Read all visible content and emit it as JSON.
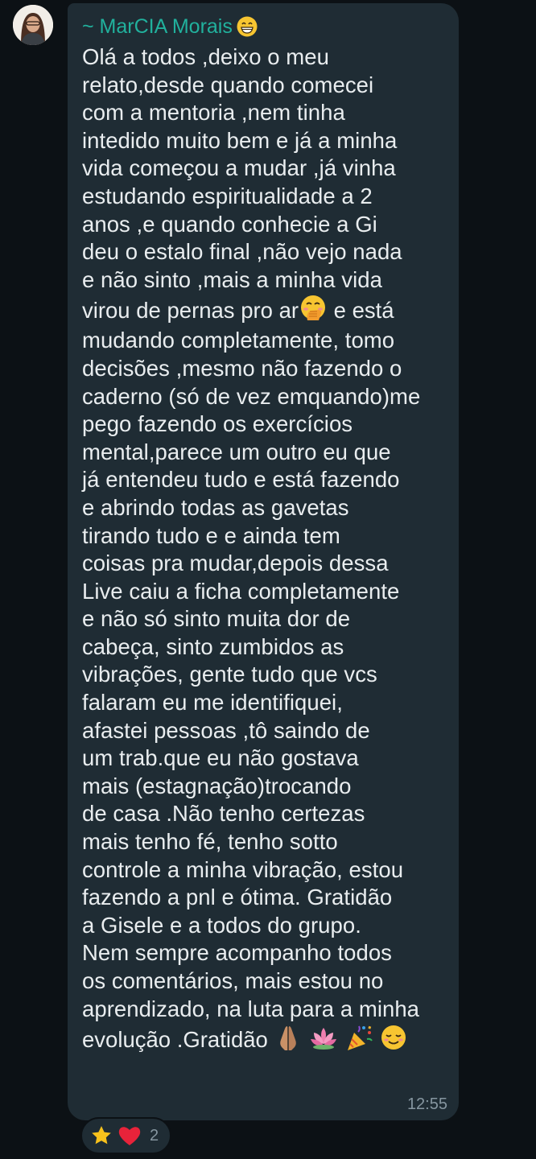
{
  "message": {
    "sender": {
      "name": "~ MarCIA Morais",
      "emoji_icon": "grinning-face-icon"
    },
    "body_lines": [
      "Olá a todos ,deixo o meu",
      "relato,desde quando comecei",
      "com a mentoria ,nem tinha",
      "intedido muito bem e já a minha",
      "vida começou a mudar ,já vinha",
      "estudando espiritualidade a 2",
      "anos ,e quando conhecie a Gi",
      "deu o estalo final ,não vejo nada",
      "e não sinto ,mais a minha vida"
    ],
    "line_virou_before": "virou de pernas pro ar",
    "line_virou_emoji": "face-with-hand-over-mouth-icon",
    "line_virou_after": " e está",
    "body_lines_2": [
      "mudando completamente, tomo",
      "decisões ,mesmo não fazendo o",
      "caderno (só de vez emquando)me",
      "pego fazendo os exercícios",
      "mental,parece um outro eu que",
      "já entendeu tudo e está fazendo",
      "e abrindo todas as gavetas",
      "tirando tudo e  e ainda tem",
      "coisas pra mudar,depois dessa",
      "Live caiu a ficha completamente",
      "e não só sinto muita dor de",
      "cabeça, sinto zumbidos as",
      "vibrações, gente tudo que vcs",
      "falaram eu me identifiquei,",
      "afastei pessoas ,tô saindo de",
      "um trab.que eu não gostava",
      "mais (estagnação)trocando",
      "de casa .Não tenho certezas",
      "mais tenho fé, tenho sotto",
      "controle a minha vibração, estou",
      "fazendo a pnl e ótima. Gratidão",
      "a Gisele e a todos do grupo.",
      "Nem sempre acompanho todos",
      "os comentários, mais estou no",
      "aprendizado, na luta para a minha"
    ],
    "closing_text": "evolução .Gratidão ",
    "closing_emojis": [
      "folded-hands-icon",
      "lotus-icon",
      "party-popper-icon",
      "relieved-face-icon"
    ],
    "timestamp": "12:55"
  },
  "reactions": {
    "icons": [
      "star-icon",
      "red-heart-icon"
    ],
    "count": "2"
  },
  "colors": {
    "background": "#0c1115",
    "bubble": "#1f2c34",
    "sender": "#21b19d",
    "text": "#e9edef",
    "meta": "#8696a0"
  }
}
